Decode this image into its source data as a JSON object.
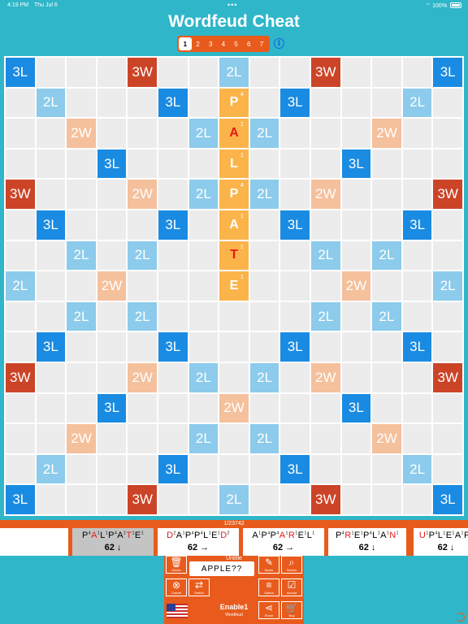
{
  "status": {
    "time": "4:19 PM",
    "date": "Thu Jul 6",
    "battery": "100%"
  },
  "app_title": "Wordfeud Cheat",
  "pages": [
    "1",
    "2",
    "3",
    "4",
    "5",
    "6",
    "7"
  ],
  "active_page": 0,
  "info_label": "i",
  "board": {
    "rows": [
      [
        "3L",
        "",
        "",
        "",
        "3W",
        "",
        "",
        "2L",
        "",
        "",
        "3W",
        "",
        "",
        "",
        "3L"
      ],
      [
        "",
        "2L",
        "",
        "",
        "",
        "3L",
        "",
        "",
        "",
        "3L",
        "",
        "",
        "",
        "2L",
        ""
      ],
      [
        "",
        "",
        "2W",
        "",
        "",
        "",
        "2L",
        "",
        "2L",
        "",
        "",
        "",
        "2W",
        "",
        ""
      ],
      [
        "",
        "",
        "",
        "3L",
        "",
        "",
        "",
        "",
        "",
        "",
        "",
        "3L",
        "",
        "",
        ""
      ],
      [
        "3W",
        "",
        "",
        "",
        "2W",
        "",
        "2L",
        "",
        "2L",
        "",
        "2W",
        "",
        "",
        "",
        "3W"
      ],
      [
        "",
        "3L",
        "",
        "",
        "",
        "3L",
        "",
        "",
        "",
        "3L",
        "",
        "",
        "",
        "3L",
        ""
      ],
      [
        "",
        "",
        "2L",
        "",
        "2L",
        "",
        "",
        "",
        "",
        "",
        "2L",
        "",
        "2L",
        "",
        ""
      ],
      [
        "2L",
        "",
        "",
        "2W",
        "",
        "",
        "",
        "",
        "",
        "",
        "",
        "2W",
        "",
        "",
        "2L"
      ],
      [
        "",
        "",
        "2L",
        "",
        "2L",
        "",
        "",
        "",
        "",
        "",
        "2L",
        "",
        "2L",
        "",
        ""
      ],
      [
        "",
        "3L",
        "",
        "",
        "",
        "3L",
        "",
        "",
        "",
        "3L",
        "",
        "",
        "",
        "3L",
        ""
      ],
      [
        "3W",
        "",
        "",
        "",
        "2W",
        "",
        "2L",
        "",
        "2L",
        "",
        "2W",
        "",
        "",
        "",
        "3W"
      ],
      [
        "",
        "",
        "",
        "3L",
        "",
        "",
        "",
        "2W",
        "",
        "",
        "",
        "3L",
        "",
        "",
        ""
      ],
      [
        "",
        "",
        "2W",
        "",
        "",
        "",
        "2L",
        "",
        "2L",
        "",
        "",
        "",
        "2W",
        "",
        ""
      ],
      [
        "",
        "2L",
        "",
        "",
        "",
        "3L",
        "",
        "",
        "",
        "3L",
        "",
        "",
        "",
        "2L",
        ""
      ],
      [
        "3L",
        "",
        "",
        "",
        "3W",
        "",
        "",
        "2L",
        "",
        "",
        "3W",
        "",
        "",
        "",
        "3L"
      ]
    ],
    "tiles": [
      {
        "row": 1,
        "col": 7,
        "letter": "P",
        "value": "4",
        "new": false
      },
      {
        "row": 2,
        "col": 7,
        "letter": "A",
        "value": "1",
        "new": true
      },
      {
        "row": 3,
        "col": 7,
        "letter": "L",
        "value": "1",
        "new": false
      },
      {
        "row": 4,
        "col": 7,
        "letter": "P",
        "value": "4",
        "new": false
      },
      {
        "row": 5,
        "col": 7,
        "letter": "A",
        "value": "1",
        "new": false
      },
      {
        "row": 6,
        "col": 7,
        "letter": "T",
        "value": "1",
        "new": true
      },
      {
        "row": 7,
        "col": 7,
        "letter": "E",
        "value": "1",
        "new": false
      }
    ]
  },
  "result_count": "1/23742",
  "results": [
    {
      "word": "",
      "score": "",
      "letters": []
    },
    {
      "score": "62 ↓",
      "selected": true,
      "letters": [
        [
          "P",
          "4",
          false
        ],
        [
          "A",
          "1",
          true
        ],
        [
          "L",
          "1",
          false
        ],
        [
          "P",
          "4",
          false
        ],
        [
          "A",
          "1",
          false
        ],
        [
          "T",
          "1",
          true
        ],
        [
          "E",
          "1",
          false
        ]
      ]
    },
    {
      "score": "62 →",
      "selected": false,
      "letters": [
        [
          "D",
          "2",
          true
        ],
        [
          "A",
          "1",
          false
        ],
        [
          "P",
          "4",
          false
        ],
        [
          "P",
          "4",
          false
        ],
        [
          "L",
          "1",
          false
        ],
        [
          "E",
          "1",
          false
        ],
        [
          "D",
          "2",
          true
        ]
      ]
    },
    {
      "score": "62 →",
      "selected": false,
      "letters": [
        [
          "A",
          "1",
          false
        ],
        [
          "P",
          "4",
          false
        ],
        [
          "P",
          "4",
          false
        ],
        [
          "A",
          "1",
          true
        ],
        [
          "R",
          "1",
          true
        ],
        [
          "E",
          "1",
          false
        ],
        [
          "L",
          "1",
          false
        ]
      ]
    },
    {
      "score": "62 ↓",
      "selected": false,
      "letters": [
        [
          "P",
          "4",
          false
        ],
        [
          "R",
          "1",
          true
        ],
        [
          "E",
          "1",
          false
        ],
        [
          "P",
          "4",
          false
        ],
        [
          "L",
          "1",
          false
        ],
        [
          "A",
          "1",
          false
        ],
        [
          "N",
          "1",
          true
        ]
      ]
    },
    {
      "score": "62 ↓",
      "selected": false,
      "letters": [
        [
          "U",
          "1",
          true
        ],
        [
          "P",
          "4",
          false
        ],
        [
          "L",
          "1",
          false
        ],
        [
          "E",
          "1",
          false
        ],
        [
          "A",
          "1",
          false
        ],
        [
          "P",
          "4",
          false
        ]
      ]
    }
  ],
  "panel": {
    "file_name": "Untitle",
    "search_text": "APPLE??",
    "buttons": {
      "delete": {
        "icon": "🗑",
        "label": "Delete"
      },
      "name": {
        "icon": "✎",
        "label": "Name"
      },
      "search": {
        "icon": "⌕",
        "label": "Search"
      },
      "cancel": {
        "icon": "⊗",
        "label": "Cancel"
      },
      "switch": {
        "icon": "⇄",
        "label": "Switch"
      },
      "option": {
        "icon": "≡",
        "label": "Option"
      },
      "accept": {
        "icon": "☑",
        "label": "Accept"
      },
      "share": {
        "icon": "⋖",
        "label": "Share"
      },
      "buy": {
        "icon": "🛒",
        "label": "Buy"
      }
    },
    "dictionary": "Enable1",
    "game": "Wordfeud"
  },
  "colors": {
    "background": "#2fb6c8",
    "accent": "#e85b1c",
    "double_letter": "#8ccbeb",
    "triple_letter": "#1a8be2",
    "double_word": "#f5c09c",
    "triple_word": "#cc4427",
    "tile": "#fbb44a",
    "new_letter": "#e61a1a"
  }
}
